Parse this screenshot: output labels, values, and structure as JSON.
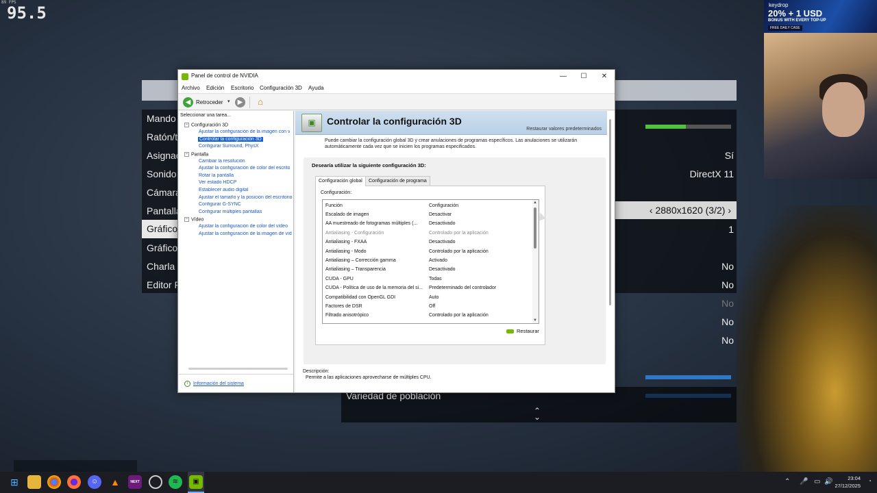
{
  "overlay": {
    "fps_small": "89 FPS",
    "fps": "95.5"
  },
  "game_menu": {
    "items": [
      "Mando",
      "Ratón/t",
      "Asignac",
      "Sonido",
      "Cámara",
      "Pantalla",
      "Gráfico",
      "Gráfico",
      "Charla c",
      "Editor F"
    ],
    "selected_index": 6,
    "values": [
      "Sí",
      "DirectX 11",
      "1",
      "No",
      "No",
      "No",
      "No",
      "No"
    ],
    "resolution": "2880x1620 (3/2)",
    "population_label": "Variedad de población",
    "slider_level": 0.47
  },
  "ad": {
    "brand": "keydrop",
    "headline": "20% + 1 USD",
    "sub": "BONUS WITH EVERY TOP-UP",
    "cta": "FREE DAILY CASE"
  },
  "window": {
    "title": "Panel de control de NVIDIA",
    "controls": {
      "minimize": "—",
      "maximize": "☐",
      "close": "✕"
    },
    "menu": [
      "Archivo",
      "Edición",
      "Escritorio",
      "Configuración 3D",
      "Ayuda"
    ],
    "toolbar": {
      "back": "Retroceder"
    },
    "task_panel": {
      "title": "Seleccionar una tarea...",
      "groups": [
        {
          "label": "Configuración 3D",
          "items": [
            "Ajustar la configuración de la imagen con v",
            "Controlar la configuración 3D",
            "Configurar Surround, PhysX"
          ]
        },
        {
          "label": "Pantalla",
          "items": [
            "Cambiar la resolución",
            "Ajustar la configuración de color del escrito",
            "Rotar la pantalla",
            "Ver estado HDCP",
            "Establecer audio digital",
            "Ajustar el tamaño y la posición del escritorio",
            "Configurar G-SYNC",
            "Configurar múltiples pantallas"
          ]
        },
        {
          "label": "Vídeo",
          "items": [
            "Ajustar la configuración de color del vídeo",
            "Ajustar la configuración de la imagen de víd"
          ]
        }
      ],
      "system_info": "Información del sistema"
    },
    "main": {
      "title": "Controlar la configuración 3D",
      "restore_defaults": "Restaurar valores predeterminados",
      "intro": "Puede cambiar la configuración global 3D y crear anulaciones de programas específicos. Las anulaciones se utilizarán automáticamente cada vez que se inicien los programas especificados.",
      "question": "Desearía utilizar la siguiente configuración 3D:",
      "tabs": [
        "Configuración global",
        "Configuración de programa"
      ],
      "config_label": "Configuración:",
      "columns": [
        "Función",
        "Configuración"
      ],
      "rows": [
        [
          "Escalado de imagen",
          "Desactivar"
        ],
        [
          "AA muestreado de fotogramas múltiples (...",
          "Desactivado"
        ],
        [
          "Antialiasing - Configuración",
          "Controlado por la aplicación"
        ],
        [
          "Antialiasing - FXAA",
          "Desactivado"
        ],
        [
          "Antialiasing - Modo",
          "Controlado por la aplicación"
        ],
        [
          "Antialiasing – Corrección gamma",
          "Activado"
        ],
        [
          "Antialiasing – Transparencia",
          "Desactivado"
        ],
        [
          "CUDA - GPU",
          "Todas"
        ],
        [
          "CUDA - Política de uso de la memoria del si...",
          "Predeterminado del controlador"
        ],
        [
          "Compatibilidad con OpenGL GDI",
          "Auto"
        ],
        [
          "Factores de DSR",
          "Off"
        ],
        [
          "Filtrado anisotrópico",
          "Controlado por la aplicación"
        ]
      ],
      "gray_row_index": 2,
      "restore": "Restaurar",
      "description_label": "Descripción:",
      "description": "Permite a las aplicaciones aprovecharse de múltiples CPU."
    }
  },
  "taskbar": {
    "apps": [
      "start-icon",
      "explorer-icon",
      "chrome-icon",
      "firefox-icon",
      "discord-icon",
      "vlc-icon",
      "next-icon",
      "steam-icon",
      "spotify-icon",
      "nvidia-icon"
    ],
    "next_label": "NEXT",
    "time": "23:04",
    "date": "27/12/2025"
  }
}
